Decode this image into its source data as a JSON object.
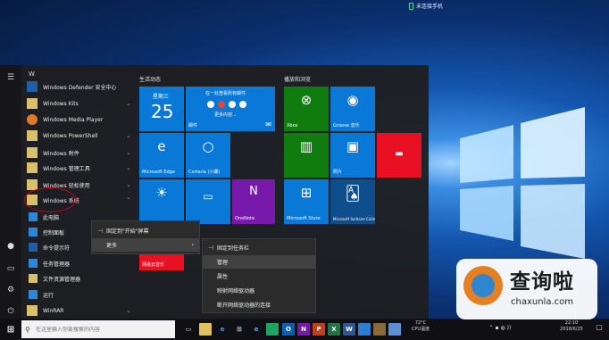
{
  "phone": {
    "label": "未连接手机"
  },
  "rail": {
    "icons": [
      "hamburger-icon",
      "user-icon",
      "documents-icon",
      "settings-icon",
      "power-icon"
    ]
  },
  "applist": {
    "letter": "W",
    "items": [
      {
        "label": "Windows Defender 安全中心",
        "chev": ""
      },
      {
        "label": "Windows Kits",
        "chev": "⌄"
      },
      {
        "label": "Windows Media Player",
        "chev": ""
      },
      {
        "label": "Windows PowerShell",
        "chev": "⌄"
      },
      {
        "label": "Windows 附件",
        "chev": "⌄"
      },
      {
        "label": "Windows 管理工具",
        "chev": "⌄"
      },
      {
        "label": "Windows 轻松使用",
        "chev": "⌄"
      },
      {
        "label": "Windows 系统",
        "chev": "⌃"
      },
      {
        "label": "此电脑",
        "chev": ""
      },
      {
        "label": "控制面板",
        "chev": ""
      },
      {
        "label": "命令提示符",
        "chev": ""
      },
      {
        "label": "任务管理器",
        "chev": ""
      },
      {
        "label": "文件资源管理器",
        "chev": ""
      },
      {
        "label": "运行",
        "chev": ""
      },
      {
        "label": "WinRAR",
        "chev": "⌄"
      }
    ]
  },
  "groups": {
    "life": "生活动态",
    "play": "播放和浏览"
  },
  "tiles": {
    "calendar_day": "星期三",
    "calendar_date": "25",
    "mail_header": "在一处查看所有邮件",
    "mail_more": "更多内容...",
    "mail": "邮件",
    "xbox": "Xbox",
    "groove": "Groove 音乐",
    "edge": "Microsoft Edge",
    "cortana": "Cortana (小娜)",
    "photos": "照片",
    "onenote": "OneNote",
    "store": "Microsoft Store",
    "solitaire": "Microsoft Solitaire Collection",
    "netease": "网易云音乐"
  },
  "ctx1": {
    "pin_start": "固定到\"开始\"屏幕",
    "more": "更多",
    "more_arrow": "›"
  },
  "ctx2": {
    "pin_taskbar": "固定到任务栏",
    "manage": "管理",
    "properties": "属性",
    "map_drive": "映射网络驱动器",
    "disconnect_drive": "断开网络驱动器的连接"
  },
  "search": {
    "placeholder": "在这里输入你要搜索的内容"
  },
  "tray": {
    "temp": "72°C",
    "cpu": "CPU温度",
    "time": "22:10",
    "date": "2018/6/25"
  },
  "watermark": {
    "cn": "查询啦",
    "en": "chaxunla.com"
  },
  "colors": {
    "accent": "#0078d7",
    "green": "#107c10",
    "red": "#e81123",
    "purple": "#7719aa"
  }
}
